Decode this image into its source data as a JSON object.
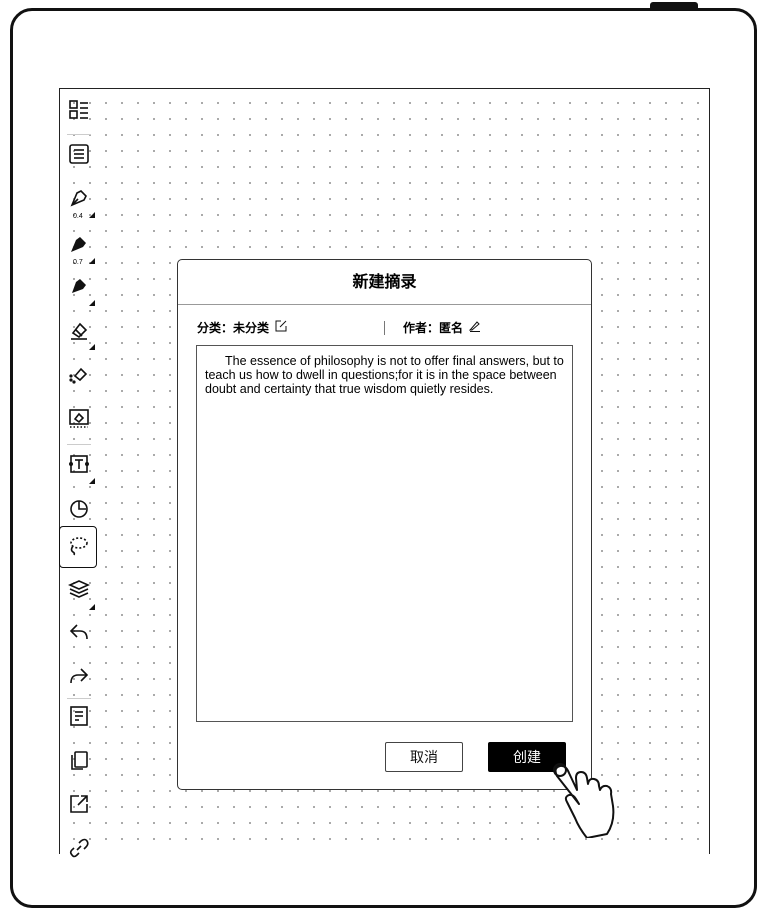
{
  "toolbar": {
    "items": [
      {
        "icon": "page-layout-icon"
      },
      {
        "icon": "list-icon"
      },
      {
        "icon": "pen-outline-icon",
        "sub": "0.4"
      },
      {
        "icon": "pen-filled-icon",
        "sub": "0.7"
      },
      {
        "icon": "marker-icon"
      },
      {
        "icon": "eraser-icon"
      },
      {
        "icon": "partial-eraser-icon"
      },
      {
        "icon": "area-eraser-icon"
      },
      {
        "icon": "text-box-icon"
      },
      {
        "icon": "shape-icon"
      },
      {
        "icon": "lasso-icon"
      },
      {
        "icon": "layers-icon"
      },
      {
        "icon": "undo-icon"
      },
      {
        "icon": "redo-icon"
      },
      {
        "icon": "template-icon"
      },
      {
        "icon": "pages-icon"
      },
      {
        "icon": "export-icon"
      },
      {
        "icon": "link-icon"
      }
    ]
  },
  "dialog": {
    "title": "新建摘录",
    "category_label": "分类：未分类",
    "author_label": "作者：匿名",
    "text": "The essence of philosophy is not to offer final answers, but to teach us how to dwell in questions;for it is in the space between doubt and certainty that true wisdom quietly resides.",
    "cancel_label": "取消",
    "create_label": "创建"
  },
  "colors": {
    "frame": "#111111",
    "primary_button": "#000000"
  }
}
